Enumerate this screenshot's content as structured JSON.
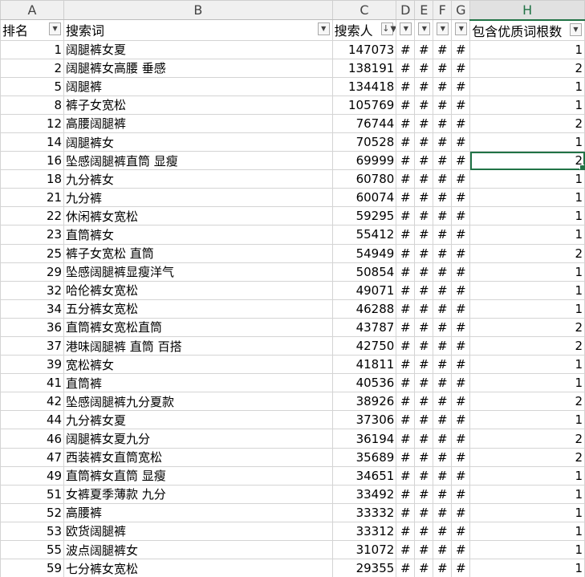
{
  "columns": [
    "A",
    "B",
    "C",
    "D",
    "E",
    "F",
    "G",
    "H"
  ],
  "headers": {
    "rank": "排名",
    "keyword": "搜索词",
    "searchers": "搜索人",
    "quality_count": "包含优质词根数"
  },
  "hash_symbol": "#",
  "rows": [
    {
      "rank": "1",
      "keyword": "阔腿裤女夏",
      "searchers": "147073",
      "count": "1"
    },
    {
      "rank": "2",
      "keyword": "阔腿裤女高腰 垂感",
      "searchers": "138191",
      "count": "2"
    },
    {
      "rank": "5",
      "keyword": "阔腿裤",
      "searchers": "134418",
      "count": "1"
    },
    {
      "rank": "8",
      "keyword": "裤子女宽松",
      "searchers": "105769",
      "count": "1"
    },
    {
      "rank": "12",
      "keyword": "高腰阔腿裤",
      "searchers": "76744",
      "count": "2"
    },
    {
      "rank": "14",
      "keyword": "阔腿裤女",
      "searchers": "70528",
      "count": "1"
    },
    {
      "rank": "16",
      "keyword": "坠感阔腿裤直筒 显瘦",
      "searchers": "69999",
      "count": "2"
    },
    {
      "rank": "18",
      "keyword": "九分裤女",
      "searchers": "60780",
      "count": "1"
    },
    {
      "rank": "21",
      "keyword": "九分裤",
      "searchers": "60074",
      "count": "1"
    },
    {
      "rank": "22",
      "keyword": "休闲裤女宽松",
      "searchers": "59295",
      "count": "1"
    },
    {
      "rank": "23",
      "keyword": "直筒裤女",
      "searchers": "55412",
      "count": "1"
    },
    {
      "rank": "25",
      "keyword": "裤子女宽松 直筒",
      "searchers": "54949",
      "count": "2"
    },
    {
      "rank": "29",
      "keyword": "坠感阔腿裤显瘦洋气",
      "searchers": "50854",
      "count": "1"
    },
    {
      "rank": "32",
      "keyword": "哈伦裤女宽松",
      "searchers": "49071",
      "count": "1"
    },
    {
      "rank": "34",
      "keyword": "五分裤女宽松",
      "searchers": "46288",
      "count": "1"
    },
    {
      "rank": "36",
      "keyword": "直筒裤女宽松直筒",
      "searchers": "43787",
      "count": "2"
    },
    {
      "rank": "37",
      "keyword": "港味阔腿裤 直筒 百搭",
      "searchers": "42750",
      "count": "2"
    },
    {
      "rank": "39",
      "keyword": "宽松裤女",
      "searchers": "41811",
      "count": "1"
    },
    {
      "rank": "41",
      "keyword": "直筒裤",
      "searchers": "40536",
      "count": "1"
    },
    {
      "rank": "42",
      "keyword": "坠感阔腿裤九分夏款",
      "searchers": "38926",
      "count": "2"
    },
    {
      "rank": "44",
      "keyword": "九分裤女夏",
      "searchers": "37306",
      "count": "1"
    },
    {
      "rank": "46",
      "keyword": "阔腿裤女夏九分",
      "searchers": "36194",
      "count": "2"
    },
    {
      "rank": "47",
      "keyword": "西装裤女直筒宽松",
      "searchers": "35689",
      "count": "2"
    },
    {
      "rank": "49",
      "keyword": "直筒裤女直筒 显瘦",
      "searchers": "34651",
      "count": "1"
    },
    {
      "rank": "51",
      "keyword": "女裤夏季薄款 九分",
      "searchers": "33492",
      "count": "1"
    },
    {
      "rank": "52",
      "keyword": "高腰裤",
      "searchers": "33332",
      "count": "1"
    },
    {
      "rank": "53",
      "keyword": "欧货阔腿裤",
      "searchers": "33312",
      "count": "1"
    },
    {
      "rank": "55",
      "keyword": "波点阔腿裤女",
      "searchers": "31072",
      "count": "1"
    },
    {
      "rank": "59",
      "keyword": "七分裤女宽松",
      "searchers": "29355",
      "count": "1"
    }
  ],
  "selected_column": "H",
  "selected_row_index": 6,
  "colors": {
    "selection": "#217346",
    "header_bg": "#f0f0f0",
    "gridline": "#d4d4d4"
  }
}
